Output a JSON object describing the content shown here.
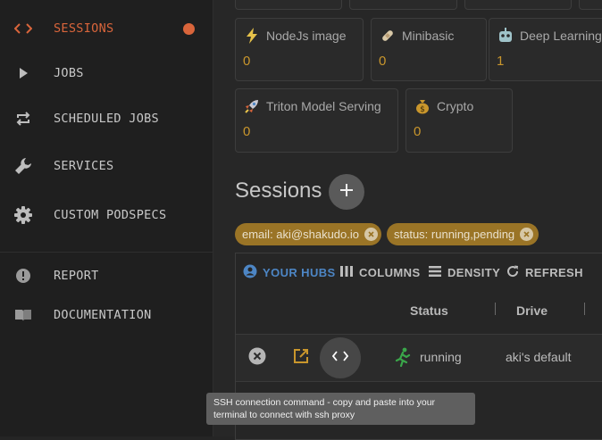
{
  "sidebar": {
    "items": [
      {
        "label": "SESSIONS",
        "icon": "code-icon",
        "active": true
      },
      {
        "label": "JOBS",
        "icon": "play-icon"
      },
      {
        "label": "SCHEDULED JOBS",
        "icon": "repeat-icon"
      },
      {
        "label": "SERVICES",
        "icon": "wrench-icon"
      },
      {
        "label": "CUSTOM PODSPECS",
        "icon": "gear-icon"
      },
      {
        "label": "REPORT",
        "icon": "alert-circle-icon"
      },
      {
        "label": "DOCUMENTATION",
        "icon": "book-icon"
      }
    ],
    "accent_color": "#d9653b"
  },
  "cards": [
    {
      "title": "NodeJs image",
      "count": "0",
      "icon": "lightning-icon"
    },
    {
      "title": "Minibasic",
      "count": "0",
      "icon": "bandage-icon"
    },
    {
      "title": "Deep Learning",
      "count": "1",
      "icon": "robot-icon"
    },
    {
      "title": "Triton Model Serving",
      "count": "0",
      "icon": "rocket-icon"
    },
    {
      "title": "Crypto",
      "count": "0",
      "icon": "money-bag-icon"
    }
  ],
  "sessions": {
    "title": "Sessions",
    "filters": [
      {
        "label": "email: aki@shakudo.io"
      },
      {
        "label": "status: running,pending"
      }
    ],
    "toolbar": {
      "your_hubs": "YOUR HUBS",
      "columns": "COLUMNS",
      "density": "DENSITY",
      "refresh": "REFRESH"
    },
    "columns": [
      "Status",
      "Drive"
    ],
    "rows": [
      {
        "status": "running",
        "drive": "aki's default"
      }
    ],
    "tooltip": "SSH connection command - copy and paste into your terminal to connect with ssh proxy"
  },
  "colors": {
    "count": "#c9962c",
    "chip": "#9a7426",
    "hubs": "#4d86c5",
    "running": "#3aa64a"
  }
}
